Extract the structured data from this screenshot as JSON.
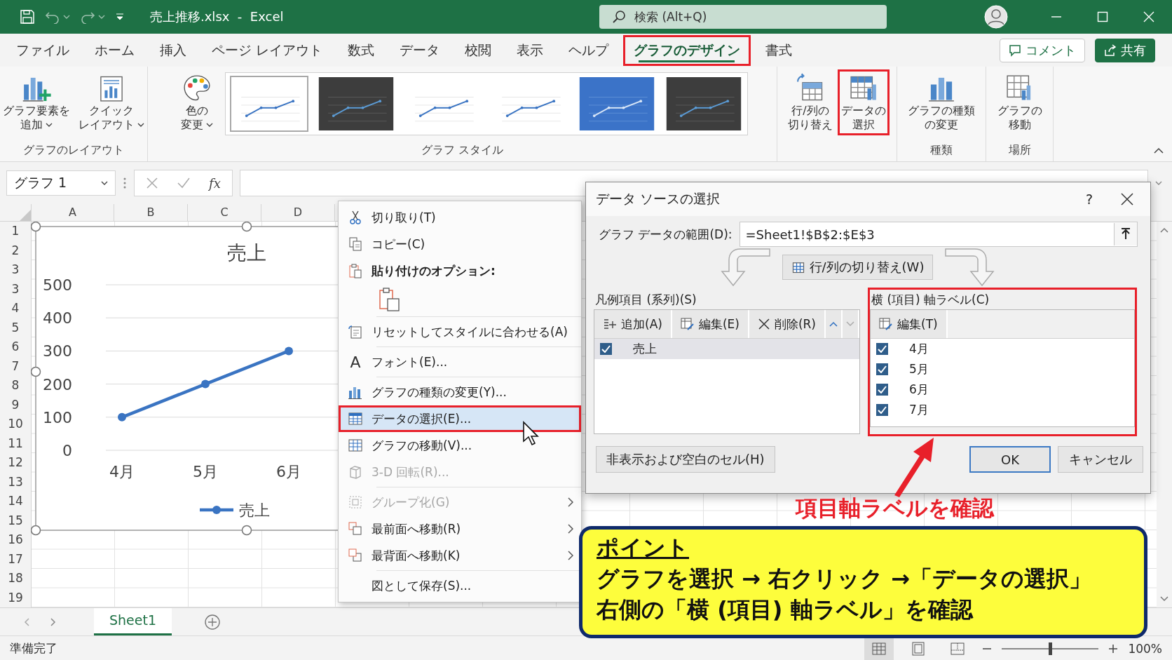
{
  "title_bar": {
    "file_title": "売上推移.xlsx  -  Excel",
    "search": {
      "placeholder": "検索 (Alt+Q)"
    }
  },
  "ribbon_tabs": [
    {
      "label": "ファイル",
      "selected": false,
      "highlighted": false
    },
    {
      "label": "ホーム",
      "selected": false,
      "highlighted": false
    },
    {
      "label": "挿入",
      "selected": false,
      "highlighted": false
    },
    {
      "label": "ページ レイアウト",
      "selected": false,
      "highlighted": false
    },
    {
      "label": "数式",
      "selected": false,
      "highlighted": false
    },
    {
      "label": "データ",
      "selected": false,
      "highlighted": false
    },
    {
      "label": "校閲",
      "selected": false,
      "highlighted": false
    },
    {
      "label": "表示",
      "selected": false,
      "highlighted": false
    },
    {
      "label": "ヘルプ",
      "selected": false,
      "highlighted": false
    },
    {
      "label": "グラフのデザイン",
      "selected": true,
      "highlighted": true
    },
    {
      "label": "書式",
      "selected": false,
      "highlighted": false
    }
  ],
  "ribbon_actions": [
    {
      "label": "コメント",
      "kind": "outline"
    },
    {
      "label": "共有",
      "kind": "primary"
    }
  ],
  "ribbon_groups": [
    {
      "label": "グラフのレイアウト",
      "commands": [
        {
          "lines": [
            "グラフ要素を",
            "追加"
          ],
          "dropdown": true,
          "highlighted": false
        },
        {
          "lines": [
            "クイック",
            "レイアウト"
          ],
          "dropdown": true,
          "highlighted": false
        }
      ]
    },
    {
      "label": "グラフ スタイル",
      "commands": [
        {
          "lines": [
            "色の",
            "変更"
          ],
          "dropdown": true,
          "highlighted": false
        }
      ],
      "styles": [
        {
          "kind": "light",
          "selected": true
        },
        {
          "kind": "dark",
          "selected": false
        },
        {
          "kind": "light",
          "selected": false
        },
        {
          "kind": "light",
          "selected": false
        },
        {
          "kind": "blue",
          "selected": false
        },
        {
          "kind": "dark",
          "selected": false
        }
      ]
    },
    {
      "commands": [
        {
          "lines": [
            "行/列の",
            "切り替え"
          ],
          "dropdown": false,
          "highlighted": false
        },
        {
          "lines": [
            "データの",
            "選択"
          ],
          "dropdown": false,
          "highlighted": true
        }
      ]
    },
    {
      "label": "種類",
      "commands": [
        {
          "lines": [
            "グラフの種類",
            "の変更"
          ],
          "dropdown": false,
          "highlighted": false
        }
      ]
    },
    {
      "label": "場所",
      "commands": [
        {
          "lines": [
            "グラフの",
            "移動"
          ],
          "dropdown": false,
          "highlighted": false
        }
      ]
    }
  ],
  "formula_bar": {
    "name_box": "グラフ 1",
    "function_label": "fx"
  },
  "sheet": {
    "columns": [
      "A",
      "B",
      "C",
      "D"
    ],
    "rows": [
      "1",
      "2",
      "3",
      "3",
      "4",
      "5",
      "6",
      "7",
      "8",
      "9",
      "10",
      "11",
      "12",
      "13",
      "14",
      "15",
      "16",
      "17",
      "18",
      "19"
    ]
  },
  "chart": {
    "chart_data": {
      "type": "line",
      "title": "売上",
      "categories": [
        "4月",
        "5月",
        "6月"
      ],
      "series": [
        {
          "name": "売上",
          "color": "#3a74c2",
          "values": [
            100,
            200,
            300
          ],
          "marker": true
        }
      ],
      "grid": true,
      "ylim": [
        0,
        500
      ],
      "yticks": [
        0,
        100,
        200,
        300,
        400,
        500
      ]
    }
  },
  "context_menu": {
    "items": [
      {
        "kind": "item",
        "label": "切り取り(T)",
        "disabled": false,
        "submenu": false,
        "highlighted": false
      },
      {
        "kind": "item",
        "label": "コピー(C)",
        "disabled": false,
        "submenu": false,
        "highlighted": false
      },
      {
        "kind": "header",
        "label": "貼り付けのオプション:"
      },
      {
        "kind": "paste"
      },
      {
        "kind": "separator"
      },
      {
        "kind": "item",
        "label": "リセットしてスタイルに合わせる(A)",
        "disabled": false,
        "submenu": false,
        "highlighted": false
      },
      {
        "kind": "separator"
      },
      {
        "kind": "item",
        "label": "フォント(E)...",
        "glyph": "A",
        "disabled": false,
        "submenu": false,
        "highlighted": false
      },
      {
        "kind": "separator"
      },
      {
        "kind": "item",
        "label": "グラフの種類の変更(Y)...",
        "disabled": false,
        "submenu": false,
        "highlighted": false
      },
      {
        "kind": "item",
        "label": "データの選択(E)...",
        "disabled": false,
        "submenu": false,
        "highlighted": true
      },
      {
        "kind": "item",
        "label": "グラフの移動(V)...",
        "disabled": false,
        "submenu": false,
        "highlighted": false
      },
      {
        "kind": "item",
        "label": "3-D 回転(R)...",
        "disabled": true,
        "submenu": false,
        "highlighted": false
      },
      {
        "kind": "separator"
      },
      {
        "kind": "item",
        "label": "グループ化(G)",
        "disabled": true,
        "submenu": true,
        "highlighted": false
      },
      {
        "kind": "item",
        "label": "最前面へ移動(R)",
        "disabled": false,
        "submenu": true,
        "highlighted": false
      },
      {
        "kind": "item",
        "label": "最背面へ移動(K)",
        "disabled": false,
        "submenu": true,
        "highlighted": false
      },
      {
        "kind": "separator"
      },
      {
        "kind": "item",
        "label": "図として保存(S)...",
        "disabled": false,
        "submenu": false,
        "highlighted": false
      }
    ]
  },
  "dialog": {
    "title": "データ ソースの選択",
    "help": "?",
    "range": {
      "label": "グラフ データの範囲(D):",
      "value": "=Sheet1!$B$2:$E$3"
    },
    "switch_button": "行/列の切り替え(W)",
    "series_panel": {
      "label": "凡例項目 (系列)(S)",
      "toolbar": [
        {
          "label": "追加(A)"
        },
        {
          "label": "編集(E)"
        },
        {
          "label": "削除(R)"
        }
      ],
      "move_up": {
        "disabled": false
      },
      "move_down": {
        "disabled": true
      },
      "items": [
        {
          "label": "売上",
          "checked": true,
          "selected": true
        }
      ]
    },
    "axis_panel": {
      "label": "横 (項目) 軸ラベル(C)",
      "highlighted": true,
      "toolbar": [
        {
          "label": "編集(T)"
        }
      ],
      "items": [
        {
          "label": "4月",
          "checked": true,
          "selected": false
        },
        {
          "label": "5月",
          "checked": true,
          "selected": false
        },
        {
          "label": "6月",
          "checked": true,
          "selected": false
        },
        {
          "label": "7月",
          "checked": true,
          "selected": false
        }
      ]
    },
    "buttons": [
      {
        "label": "非表示および空白のセル(H)",
        "kind": "secondary"
      },
      {
        "label": "OK",
        "kind": "default"
      },
      {
        "label": "キャンセル",
        "kind": "normal"
      }
    ]
  },
  "annotation": {
    "note": "項目軸ラベルを確認"
  },
  "callout": {
    "title": "ポイント",
    "lines": [
      "グラフを選択 → 右クリック →「データの選択」",
      "右側の「横 (項目) 軸ラベル」を確認"
    ]
  },
  "sheet_tabs": [
    {
      "label": "Sheet1",
      "selected": true
    }
  ],
  "status_bar": {
    "status": "準備完了",
    "views": [
      {
        "selected": true
      },
      {
        "selected": false
      },
      {
        "selected": false
      }
    ],
    "zoom": {
      "level": 0.5,
      "reading": "100%"
    }
  }
}
